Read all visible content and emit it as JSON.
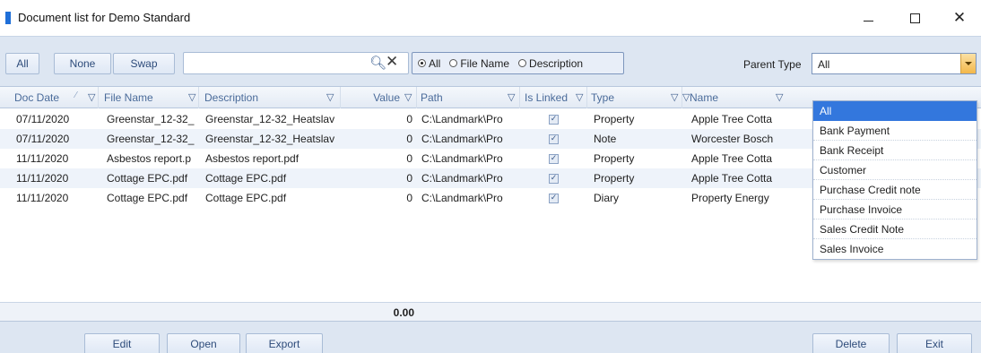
{
  "window": {
    "title": "Document list for Demo Standard",
    "controls": [
      "minimize",
      "maximize",
      "close"
    ]
  },
  "toolbar": {
    "all_label": "All",
    "none_label": "None",
    "swap_label": "Swap",
    "search_value": "",
    "search_icon": "magnifier-icon",
    "clear_icon": "x-icon",
    "filter_options": {
      "all": "All",
      "file_name": "File Name",
      "description": "Description",
      "selected": "All"
    },
    "parent_type_label": "Parent Type",
    "parent_type_value": "All"
  },
  "grid": {
    "columns": [
      "Doc Date",
      "File Name",
      "Description",
      "Value",
      "Path",
      "Is Linked",
      "Type",
      "Name"
    ],
    "rows": [
      {
        "doc_date": "07/11/2020",
        "file_name": "Greenstar_12-32_",
        "description": "Greenstar_12-32_Heatslav",
        "value": "0",
        "path": "C:\\Landmark\\Pro",
        "is_linked": true,
        "type": "Property",
        "name": "Apple Tree Cotta"
      },
      {
        "doc_date": "07/11/2020",
        "file_name": "Greenstar_12-32_",
        "description": "Greenstar_12-32_Heatslav",
        "value": "0",
        "path": "C:\\Landmark\\Pro",
        "is_linked": true,
        "type": "Note",
        "name": "Worcester Bosch"
      },
      {
        "doc_date": "11/11/2020",
        "file_name": "Asbestos report.p",
        "description": "Asbestos report.pdf",
        "value": "0",
        "path": "C:\\Landmark\\Pro",
        "is_linked": true,
        "type": "Property",
        "name": "Apple Tree Cotta"
      },
      {
        "doc_date": "11/11/2020",
        "file_name": "Cottage EPC.pdf",
        "description": "Cottage EPC.pdf",
        "value": "0",
        "path": "C:\\Landmark\\Pro",
        "is_linked": true,
        "type": "Property",
        "name": "Apple Tree Cotta"
      },
      {
        "doc_date": "11/11/2020",
        "file_name": "Cottage EPC.pdf",
        "description": "Cottage EPC.pdf",
        "value": "0",
        "path": "C:\\Landmark\\Pro",
        "is_linked": true,
        "type": "Diary",
        "name": "Property Energy"
      }
    ],
    "total_value": "0.00"
  },
  "parent_type_dropdown": {
    "items": [
      "All",
      "Bank Payment",
      "Bank Receipt",
      "Customer",
      "Purchase Credit note",
      "Purchase Invoice",
      "Sales Credit Note",
      "Sales Invoice"
    ],
    "selected_index": 0
  },
  "bottom": {
    "edit_label": "Edit",
    "open_label": "Open",
    "export_label": "Export",
    "delete_label": "Delete",
    "exit_label": "Exit"
  },
  "colors": {
    "accent": "#3377dd",
    "toolbar_bg": "#dde6f2",
    "header_text": "#4a6b9a",
    "combo_button": "#f3b749"
  }
}
